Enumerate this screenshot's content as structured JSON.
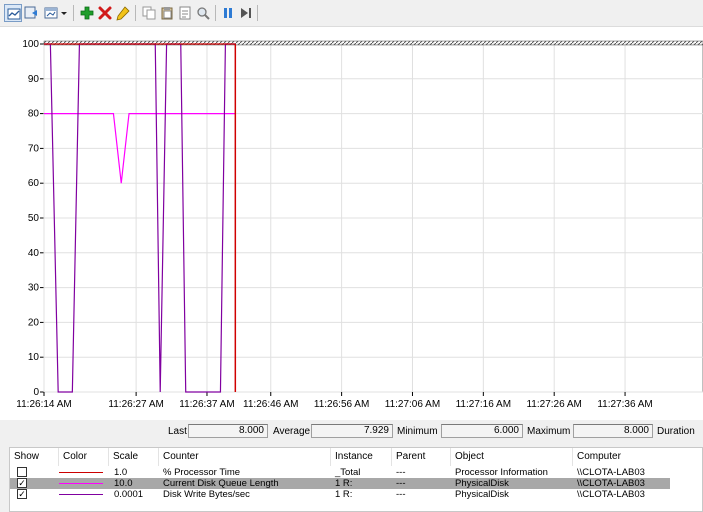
{
  "toolbar": {
    "buttons": [
      {
        "name": "change-graph-type-icon"
      },
      {
        "name": "view-current-activity-icon"
      },
      {
        "name": "view-log-data-icon"
      },
      {
        "name": "dropdown-arrow-icon"
      },
      {
        "name": "add-counter-icon"
      },
      {
        "name": "delete-counter-icon"
      },
      {
        "name": "highlight-icon"
      },
      {
        "name": "copy-properties-icon"
      },
      {
        "name": "paste-counter-list-icon"
      },
      {
        "name": "properties-icon"
      },
      {
        "name": "zoom-icon"
      },
      {
        "name": "freeze-display-icon"
      },
      {
        "name": "update-data-icon"
      }
    ]
  },
  "chart_data": {
    "type": "line",
    "ylim": [
      0,
      100
    ],
    "y_ticks": [
      "100",
      "90",
      "80",
      "70",
      "60",
      "50",
      "40",
      "30",
      "20",
      "10",
      "0"
    ],
    "x_ticks": [
      "11:26:14 AM",
      "11:26:27 AM",
      "11:26:37 AM",
      "11:26:46 AM",
      "11:26:56 AM",
      "11:27:06 AM",
      "11:27:16 AM",
      "11:27:26 AM",
      "11:27:36 AM"
    ],
    "x_tick_positions_sec": [
      0,
      13,
      23,
      32,
      42,
      52,
      62,
      72,
      82
    ],
    "x_range_sec": [
      0,
      93
    ],
    "current_time_sec": 27,
    "grid": true,
    "series": [
      {
        "color": "#ff00ff",
        "points": [
          [
            0,
            80
          ],
          [
            9.8,
            80
          ],
          [
            10.9,
            60
          ],
          [
            12,
            80
          ],
          [
            27,
            80
          ]
        ]
      },
      {
        "color": "#8000a0",
        "points": [
          [
            0,
            100
          ],
          [
            0.9,
            100
          ],
          [
            2,
            0
          ],
          [
            4,
            0
          ],
          [
            5,
            100
          ],
          [
            15.7,
            100
          ],
          [
            16.4,
            0
          ],
          [
            17.3,
            100
          ],
          [
            19.3,
            100
          ],
          [
            20,
            0
          ],
          [
            24.9,
            0
          ],
          [
            25.6,
            100
          ],
          [
            27,
            100
          ]
        ]
      },
      {
        "color": "#cc0000",
        "points": [
          [
            0,
            100
          ],
          [
            27,
            100
          ]
        ]
      }
    ]
  },
  "stats": {
    "last_label": "Last",
    "last_value": "8.000",
    "average_label": "Average",
    "average_value": "7.929",
    "minimum_label": "Minimum",
    "minimum_value": "6.000",
    "maximum_label": "Maximum",
    "maximum_value": "8.000",
    "duration_label": "Duration"
  },
  "counters": {
    "headers": [
      "Show",
      "Color",
      "Scale",
      "Counter",
      "Instance",
      "Parent",
      "Object",
      "Computer"
    ],
    "rows": [
      {
        "checked": false,
        "color": "#cc0000",
        "scale": "1.0",
        "counter": "% Processor Time",
        "instance": "_Total",
        "parent": "---",
        "object": "Processor Information",
        "computer": "\\\\CLOTA-LAB03"
      },
      {
        "checked": true,
        "color": "#ff00ff",
        "scale": "10.0",
        "counter": "Current Disk Queue Length",
        "instance": "1 R:",
        "parent": "---",
        "object": "PhysicalDisk",
        "computer": "\\\\CLOTA-LAB03"
      },
      {
        "checked": true,
        "color": "#8000a0",
        "scale": "0.0001",
        "counter": "Disk Write Bytes/sec",
        "instance": "1 R:",
        "parent": "---",
        "object": "PhysicalDisk",
        "computer": "\\\\CLOTA-LAB03"
      }
    ]
  }
}
